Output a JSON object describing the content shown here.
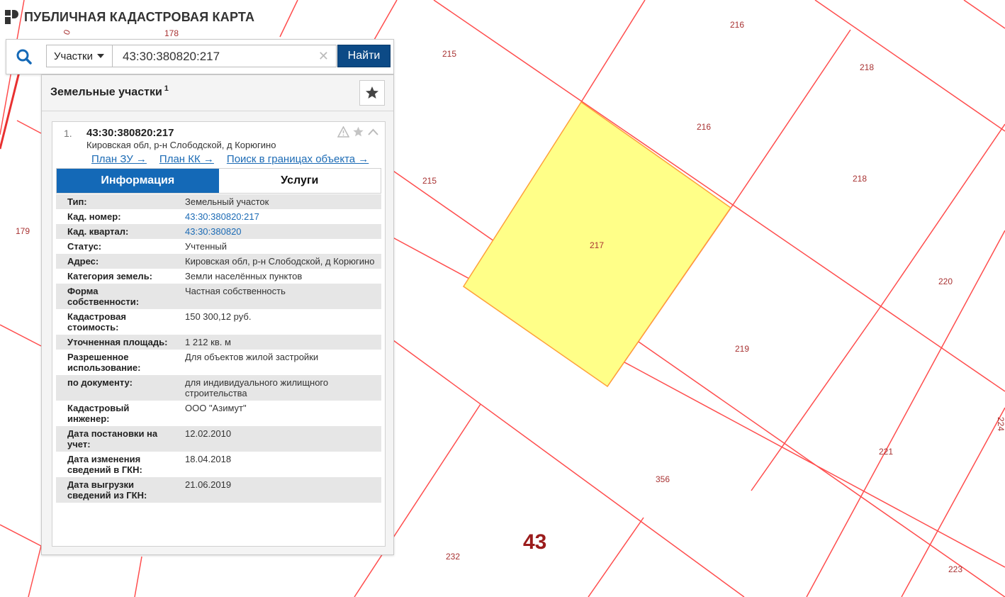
{
  "header": {
    "title": "ПУБЛИЧНАЯ КАДАСТРОВАЯ КАРТА"
  },
  "search": {
    "type_label": "Участки",
    "query": "43:30:380820:217",
    "clear_glyph": "✕",
    "find_label": "Найти"
  },
  "results": {
    "title": "Земельные участки",
    "count": "1",
    "item": {
      "num": "1.",
      "cad_number": "43:30:380820:217",
      "address": "Кировская обл, р-н Слободской, д Корюгино",
      "links": [
        "План ЗУ →",
        "План КК →",
        "Поиск в границах объекта →"
      ],
      "tabs": [
        "Информация",
        "Услуги"
      ],
      "rows": [
        {
          "key": "Тип:",
          "value": "Земельный участок"
        },
        {
          "key": "Кад. номер:",
          "value": "43:30:380820:217"
        },
        {
          "key": "Кад. квартал:",
          "value": "43:30:380820"
        },
        {
          "key": "Статус:",
          "value": "Учтенный"
        },
        {
          "key": "Адрес:",
          "value": "Кировская обл, р-н Слободской, д Корюгино"
        },
        {
          "key": "Категория земель:",
          "value": "Земли населённых пунктов"
        },
        {
          "key": "Форма собственности:",
          "value": "Частная собственность"
        },
        {
          "key": "Кадастровая стоимость:",
          "value": "150 300,12 руб."
        },
        {
          "key": "Уточненная площадь:",
          "value": "1 212 кв. м"
        },
        {
          "key": "Разрешенное использование:",
          "value": "Для объектов жилой застройки"
        },
        {
          "key": "по документу:",
          "value": "для индивидуального жилищного строительства"
        },
        {
          "key": "Кадастровый инженер:",
          "value": "ООО \"Азимут\""
        },
        {
          "key": "Дата постановки на учет:",
          "value": "12.02.2010"
        },
        {
          "key": "Дата изменения сведений в ГКН:",
          "value": "18.04.2018"
        },
        {
          "key": "Дата выгрузки сведений из ГКН:",
          "value": "21.06.2019"
        }
      ]
    }
  },
  "map": {
    "parcel_color": "#ffff88",
    "boundary_color": "#ff4d4d",
    "labels": {
      "l178": "178",
      "l179": "179",
      "l215a": "215",
      "l215b": "215",
      "l216a": "216",
      "l216b": "216",
      "l218a": "218",
      "l218b": "218",
      "l217": "217",
      "l219": "219",
      "l220": "220",
      "l221": "221",
      "l356": "356",
      "l232": "232",
      "l223": "223",
      "l224": "224",
      "l0": "0",
      "quarter": "43"
    }
  }
}
